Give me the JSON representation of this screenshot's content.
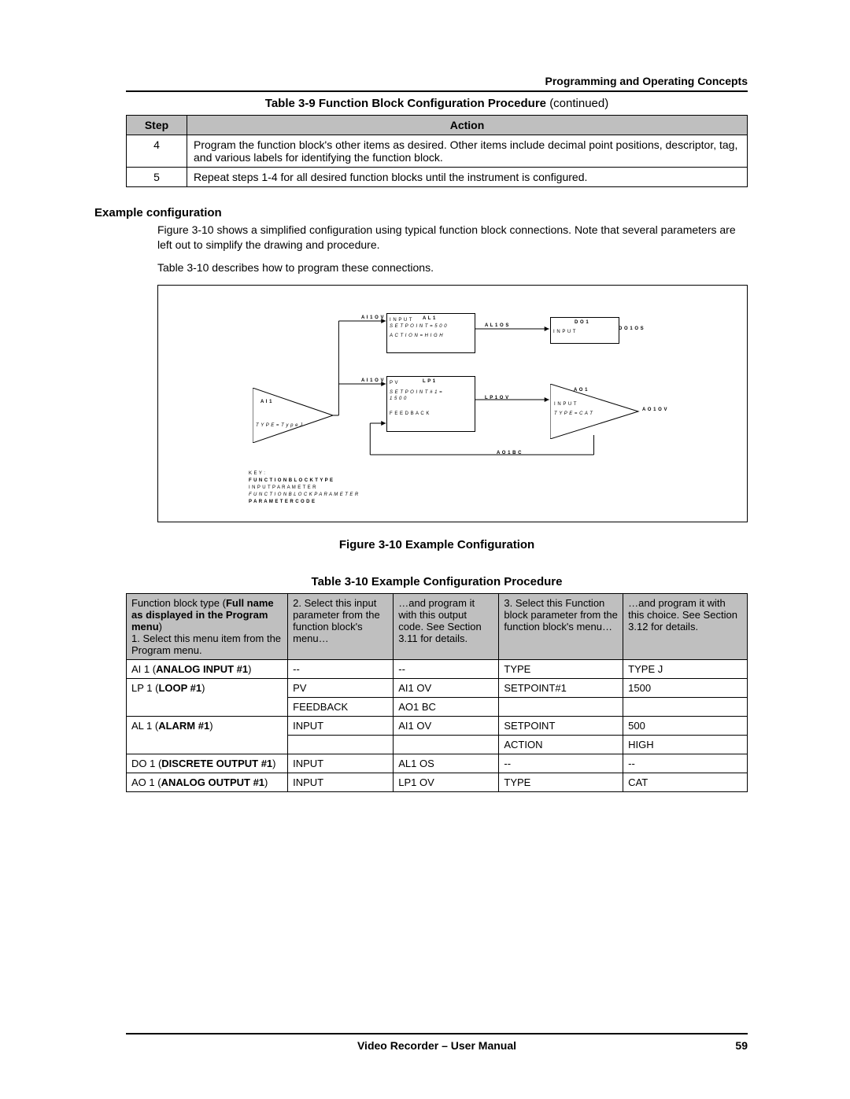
{
  "header": {
    "section_title": "Programming and Operating Concepts"
  },
  "table39": {
    "title_prefix": "Table 3-9   Function Block Configuration Procedure ",
    "title_suffix": "(continued)",
    "col_step": "Step",
    "col_action": "Action",
    "rows": [
      {
        "step": "4",
        "action": "Program the function block's other items as desired.  Other items include decimal point positions, descriptor, tag, and various labels for identifying the function block."
      },
      {
        "step": "5",
        "action": "Repeat steps 1-4 for all desired function blocks until the instrument is configured."
      }
    ]
  },
  "example_section": {
    "heading": "Example configuration",
    "para1": "Figure 3-10 shows a simplified configuration using typical function block connections.  Note that several parameters are left out to simplify the drawing and procedure.",
    "para2": "Table 3-10 describes how to program these connections."
  },
  "figure": {
    "caption": "Figure 3-10   Example Configuration",
    "blocks": {
      "al1_title": "A L  1",
      "al1_l1": "I N P U T",
      "al1_l2": "S E T P O I N T  =  5 0 0",
      "al1_l3": "A C T I O N  =  H I G H",
      "al1_sig": "A L 1 O S",
      "do1_title": "D O  1",
      "do1_l1": "I N P U T",
      "do1_sig": "D O 1 O S",
      "lp1_title": "L P  1",
      "lp1_l1": "P  V",
      "lp1_l2": "S E T P O I N T # 1   =",
      "lp1_l2b": "1 5 0 0",
      "lp1_l3": "F E E D B A C K",
      "lp1_sig": "L P 1 O V",
      "ai1_title": "A I  1",
      "ai1_l1": "T Y P E  =   T y p e  J",
      "ai1_sig": "A I 1 O V",
      "ao1_title": "A O  1",
      "ao1_l1": "I N P U T",
      "ao1_l2": "T Y P E  =   C A T",
      "ao1_sig": "A O 1 O V",
      "ao1bc": "A O 1 B C"
    },
    "key": {
      "k0": "K E Y :",
      "k1": "F U N C T I O N   B L O C K   T Y P E",
      "k2": "I N P U T   P A R A M E T E R",
      "k3": "F U N C T I O N   B L O C K   P A R A M E T E R",
      "k4": "P A R A M E T E R   C O D E"
    }
  },
  "table310": {
    "title": "Table 3-10  Example Configuration Procedure",
    "headers": {
      "c1a": "Function block type (",
      "c1b": "Full name as displayed in the Program menu",
      "c1c": ")",
      "c1d": "1. Select this menu item from the Program menu.",
      "c2": "2. Select this input parameter from the function block's menu…",
      "c3": "…and program it with this output code.  See Section 3.11 for details.",
      "c4": "3. Select this Function block parameter from the function block's menu…",
      "c5": "…and program it with this choice.  See Section 3.12 for details."
    },
    "rows": [
      {
        "c1p": "AI 1 (",
        "c1b": "ANALOG INPUT #1",
        "c1s": ")",
        "c2": "--",
        "c3": "--",
        "c4": "TYPE",
        "c5": "TYPE J"
      },
      {
        "c1p": "LP 1 (",
        "c1b": "LOOP #1",
        "c1s": ")",
        "c2": "PV",
        "c3": "AI1 OV",
        "c4": "SETPOINT#1",
        "c5": "1500"
      },
      {
        "c1p": "",
        "c1b": "",
        "c1s": "",
        "c2": "FEEDBACK",
        "c3": "AO1 BC",
        "c4": "",
        "c5": ""
      },
      {
        "c1p": "AL 1 (",
        "c1b": "ALARM #1",
        "c1s": ")",
        "c2": "INPUT",
        "c3": "AI1 OV",
        "c4": "SETPOINT",
        "c5": "500"
      },
      {
        "c1p": "",
        "c1b": "",
        "c1s": "",
        "c2": "",
        "c3": "",
        "c4": "ACTION",
        "c5": "HIGH"
      },
      {
        "c1p": "DO 1 (",
        "c1b": "DISCRETE OUTPUT #1",
        "c1s": ")",
        "c2": "INPUT",
        "c3": "AL1 OS",
        "c4": "--",
        "c5": "--"
      },
      {
        "c1p": "AO 1 (",
        "c1b": "ANALOG OUTPUT #1",
        "c1s": ")",
        "c2": "INPUT",
        "c3": "LP1 OV",
        "c4": "TYPE",
        "c5": "CAT"
      }
    ]
  },
  "footer": {
    "manual": "Video Recorder – User Manual",
    "page": "59"
  }
}
